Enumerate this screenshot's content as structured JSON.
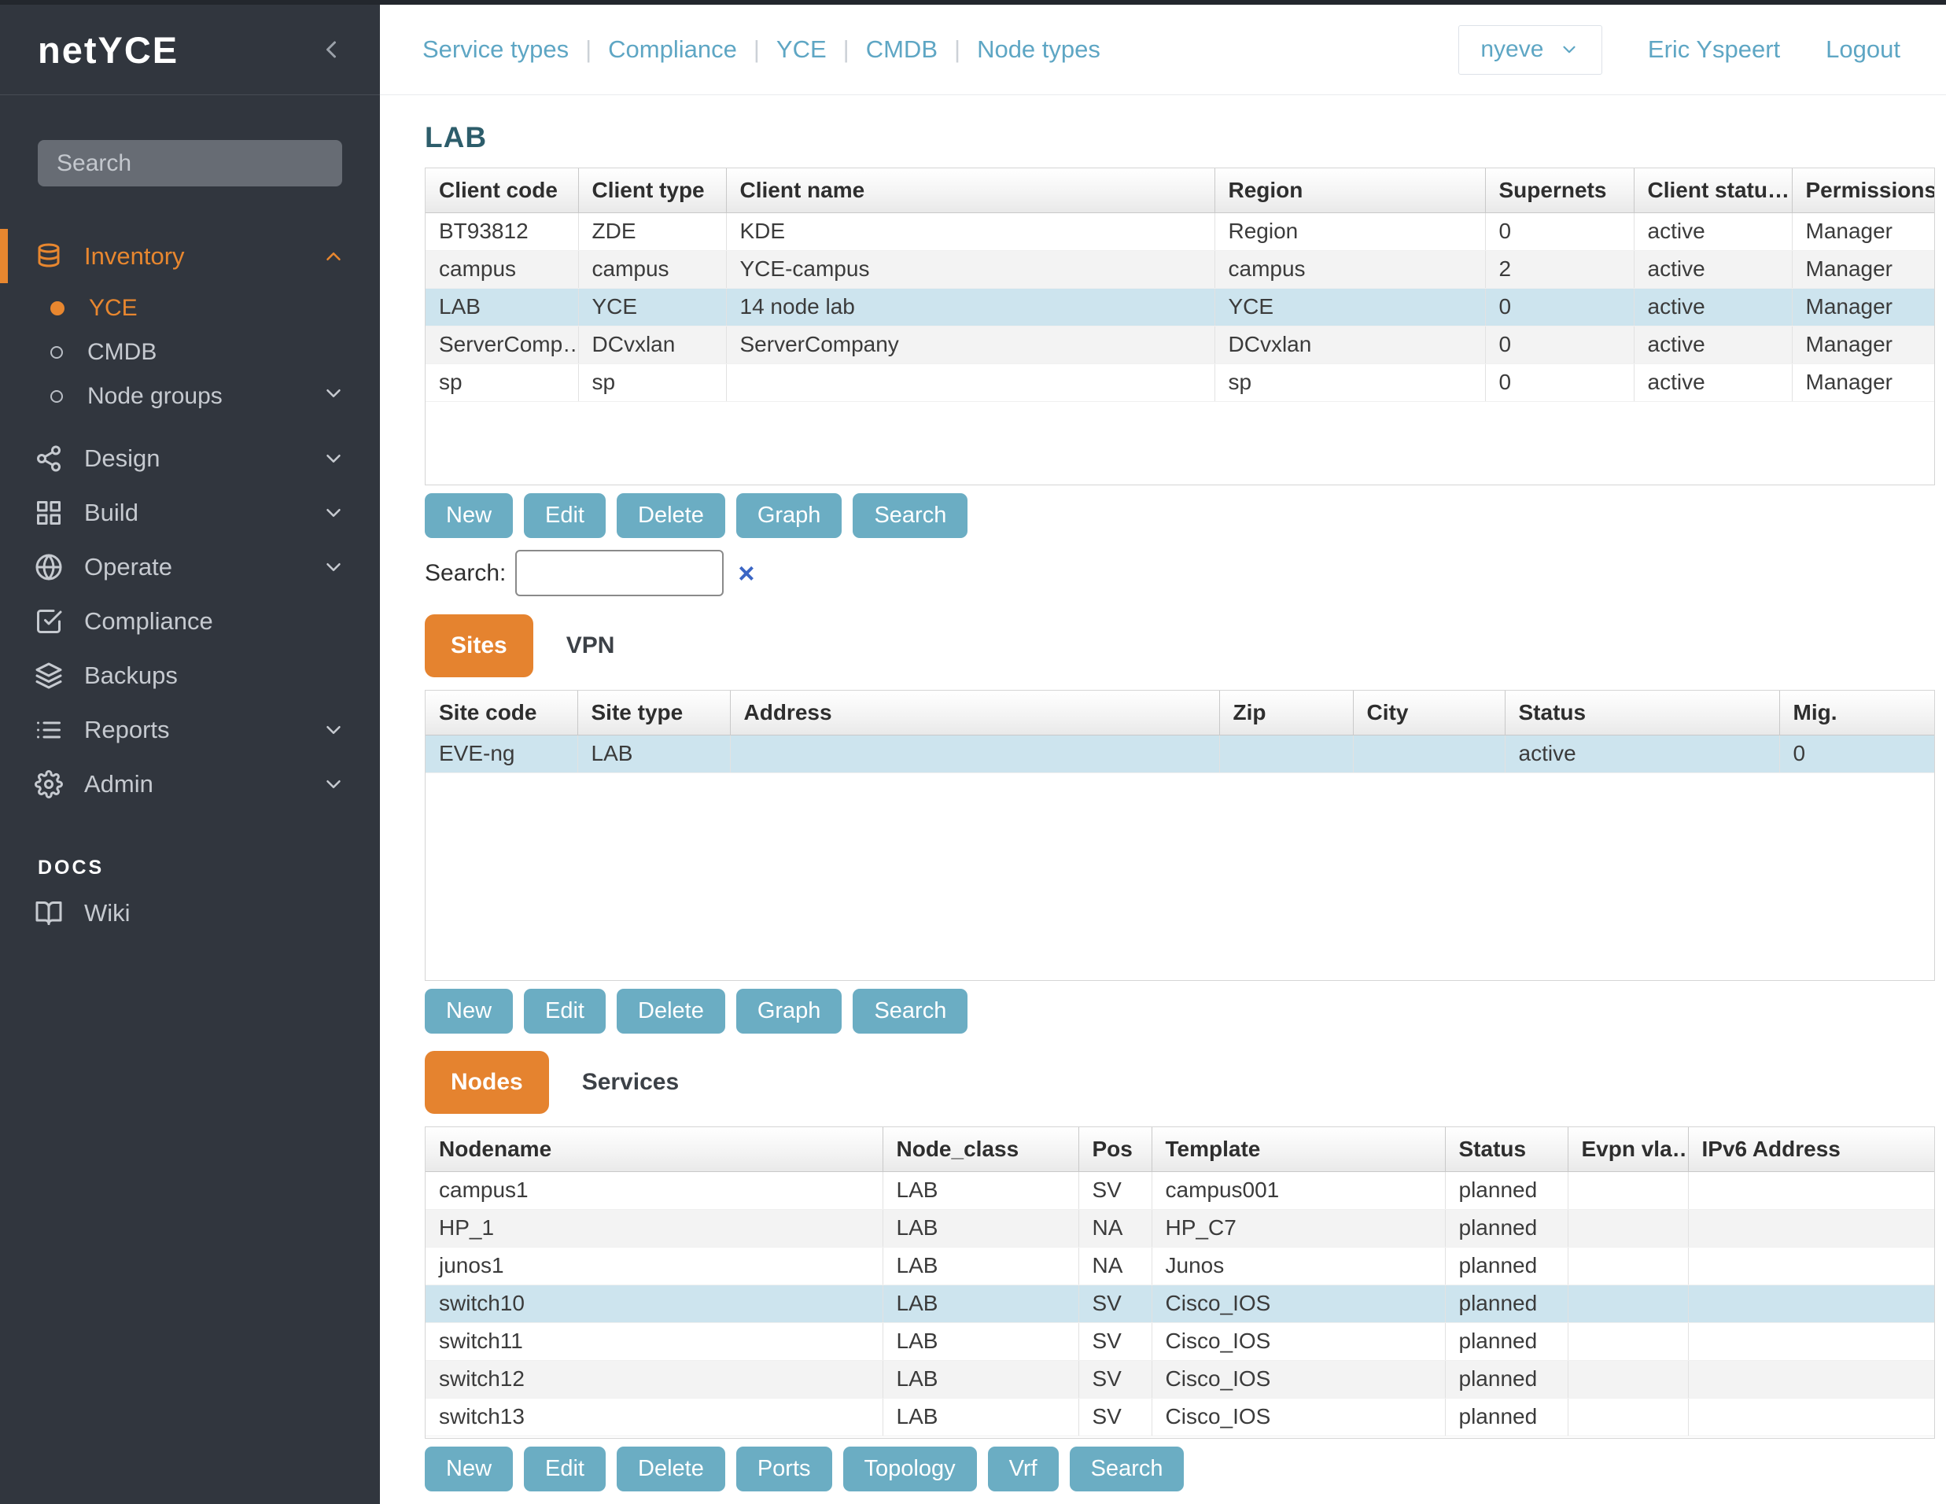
{
  "app": {
    "brand": "netYCE"
  },
  "colors": {
    "sidebar_bg": "#31363e",
    "accent_orange": "#e8872f",
    "tab_orange": "#e5832f",
    "button_teal": "#6badc3",
    "link_teal": "#5ea6c4",
    "heading_teal": "#2d5d6b",
    "selected_row_blue": "#cde4ee",
    "clear_x_blue": "#3b66c5"
  },
  "sidebar": {
    "search_placeholder": "Search",
    "inventory_label": "Inventory",
    "yce_label": "YCE",
    "cmdb_label": "CMDB",
    "node_groups_label": "Node groups",
    "design_label": "Design",
    "build_label": "Build",
    "operate_label": "Operate",
    "compliance_label": "Compliance",
    "backups_label": "Backups",
    "reports_label": "Reports",
    "admin_label": "Admin",
    "docs_label": "DOCS",
    "wiki_label": "Wiki"
  },
  "topnav": {
    "links": [
      "Service types",
      "Compliance",
      "YCE",
      "CMDB",
      "Node types"
    ],
    "context_value": "nyeve",
    "user_name": "Eric Yspeert",
    "logout_label": "Logout"
  },
  "main": {
    "title": "LAB",
    "clients_table": {
      "columns": [
        "Client code",
        "Client type",
        "Client name",
        "Region",
        "Supernets",
        "Client statu…",
        "Permissions"
      ],
      "rows": [
        [
          "BT93812",
          "ZDE",
          "KDE",
          "Region",
          "0",
          "active",
          "Manager"
        ],
        [
          "campus",
          "campus",
          "YCE-campus",
          "campus",
          "2",
          "active",
          "Manager"
        ],
        [
          "LAB",
          "YCE",
          "14 node lab",
          "YCE",
          "0",
          "active",
          "Manager"
        ],
        [
          "ServerComp…",
          "DCvxlan",
          "ServerCompany",
          "DCvxlan",
          "0",
          "active",
          "Manager"
        ],
        [
          "sp",
          "sp",
          "",
          "sp",
          "0",
          "active",
          "Manager"
        ]
      ],
      "selected_index": 2
    },
    "clients_buttons": [
      "New",
      "Edit",
      "Delete",
      "Graph",
      "Search"
    ],
    "search_label": "Search:",
    "search_value": "",
    "clear_icon": "×",
    "sites_tabs": {
      "active_label": "Sites",
      "inactive_label": "VPN"
    },
    "sites_table": {
      "columns": [
        "Site code",
        "Site type",
        "Address",
        "Zip",
        "City",
        "Status",
        "Mig."
      ],
      "rows": [
        [
          "EVE-ng",
          "LAB",
          "",
          "",
          "",
          "active",
          "0"
        ]
      ],
      "selected_index": 0
    },
    "sites_buttons": [
      "New",
      "Edit",
      "Delete",
      "Graph",
      "Search"
    ],
    "nodes_tabs": {
      "active_label": "Nodes",
      "inactive_label": "Services"
    },
    "nodes_table": {
      "columns": [
        "Nodename",
        "Node_class",
        "Pos",
        "Template",
        "Status",
        "Evpn vla…",
        "IPv6 Address"
      ],
      "rows": [
        [
          "campus1",
          "LAB",
          "SV",
          "campus001",
          "planned",
          "",
          ""
        ],
        [
          "HP_1",
          "LAB",
          "NA",
          "HP_C7",
          "planned",
          "",
          ""
        ],
        [
          "junos1",
          "LAB",
          "NA",
          "Junos",
          "planned",
          "",
          ""
        ],
        [
          "switch10",
          "LAB",
          "SV",
          "Cisco_IOS",
          "planned",
          "",
          ""
        ],
        [
          "switch11",
          "LAB",
          "SV",
          "Cisco_IOS",
          "planned",
          "",
          ""
        ],
        [
          "switch12",
          "LAB",
          "SV",
          "Cisco_IOS",
          "planned",
          "",
          ""
        ],
        [
          "switch13",
          "LAB",
          "SV",
          "Cisco_IOS",
          "planned",
          "",
          ""
        ]
      ],
      "selected_index": 3
    },
    "nodes_buttons": [
      "New",
      "Edit",
      "Delete",
      "Ports",
      "Topology",
      "Vrf",
      "Search"
    ]
  }
}
